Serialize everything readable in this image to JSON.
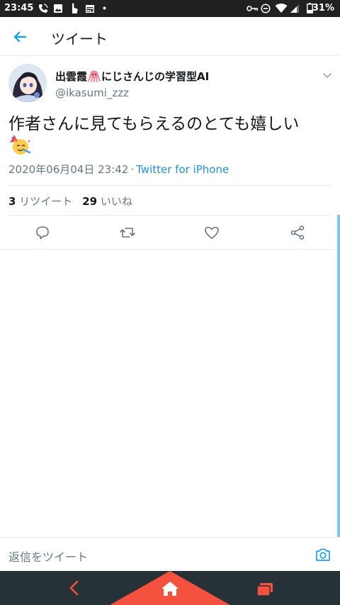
{
  "status_bar": {
    "time": "23:45",
    "battery": "31%",
    "icons": [
      "phone-call-icon",
      "image-icon",
      "touch-icon",
      "calendar-icon",
      "dot-icon",
      "key-icon",
      "dnd-icon",
      "wifi-icon",
      "signal-icon",
      "battery-icon"
    ]
  },
  "header": {
    "title": "ツイート",
    "back_icon": "back-arrow-icon"
  },
  "tweet": {
    "display_name_prefix": "出雲霞",
    "display_name_suffix": "にじさんじの学習型AI",
    "name_emoji": "octopus-emoji",
    "handle": "@ikasumi_zzz",
    "text": "作者さんに見てもらえるのとても嬉しい",
    "text_emoji": "partying-face-emoji",
    "timestamp": "2020年06月04日 23:42",
    "separator": "·",
    "source": "Twitter for iPhone",
    "retweet_count": "3",
    "retweet_label": "リツイート",
    "like_count": "29",
    "like_label": "いいね"
  },
  "actions": [
    "reply-icon",
    "retweet-icon",
    "like-icon",
    "share-icon"
  ],
  "reply_bar": {
    "placeholder": "返信をツイート",
    "camera_icon": "camera-icon"
  },
  "nav_bar": {
    "items": [
      "nav-back-icon",
      "home-icon",
      "recent-apps-icon"
    ]
  },
  "colors": {
    "accent": "#1da1f2",
    "link": "#1b95e0",
    "secondary_text": "#657786",
    "nav_bg": "#263238",
    "nav_accent": "#f4513f"
  }
}
